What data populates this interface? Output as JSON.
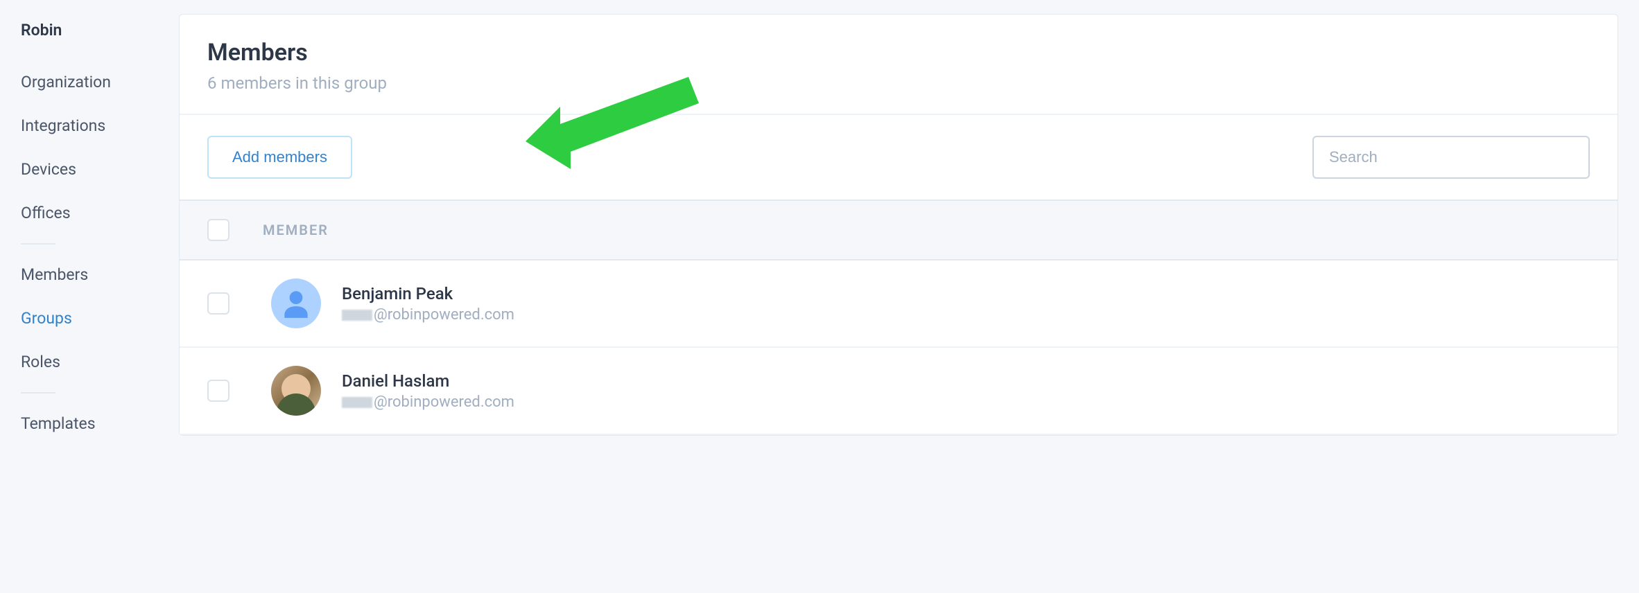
{
  "sidebar": {
    "title": "Robin",
    "items": [
      {
        "label": "Organization",
        "active": false
      },
      {
        "label": "Integrations",
        "active": false
      },
      {
        "label": "Devices",
        "active": false
      },
      {
        "label": "Offices",
        "active": false
      }
    ],
    "items2": [
      {
        "label": "Members",
        "active": false
      },
      {
        "label": "Groups",
        "active": true
      },
      {
        "label": "Roles",
        "active": false
      }
    ],
    "items3": [
      {
        "label": "Templates",
        "active": false
      }
    ]
  },
  "header": {
    "title": "Members",
    "subtitle": "6 members in this group"
  },
  "toolbar": {
    "add_label": "Add members",
    "search_placeholder": "Search"
  },
  "table": {
    "column_label": "MEMBER"
  },
  "members": [
    {
      "name": "Benjamin Peak",
      "email_domain": "@robinpowered.com",
      "avatar_type": "default"
    },
    {
      "name": "Daniel Haslam",
      "email_domain": "@robinpowered.com",
      "avatar_type": "photo"
    }
  ]
}
